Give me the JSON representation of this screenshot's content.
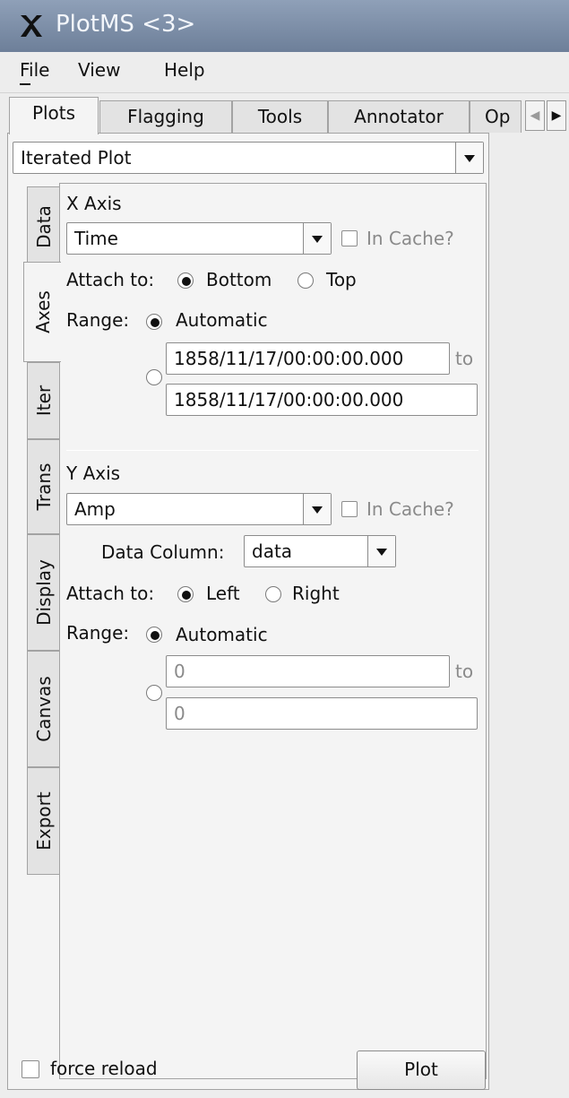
{
  "window": {
    "title": "PlotMS <3>"
  },
  "menu": {
    "items": [
      "File",
      "View",
      "Help"
    ]
  },
  "tabs": [
    "Plots",
    "Flagging",
    "Tools",
    "Annotator",
    "Op"
  ],
  "plot_type": "Iterated Plot",
  "side_tabs": [
    "Data",
    "Axes",
    "Iter",
    "Trans",
    "Display",
    "Canvas",
    "Export"
  ],
  "x_axis": {
    "heading": "X Axis",
    "value": "Time",
    "in_cache_label": "In Cache?",
    "attach_label": "Attach to:",
    "attach_options": [
      "Bottom",
      "Top"
    ],
    "attach_selected": "Bottom",
    "range_label": "Range:",
    "range_auto_label": "Automatic",
    "range_from": "1858/11/17/00:00:00.000",
    "range_to": "1858/11/17/00:00:00.000",
    "to_label": "to"
  },
  "y_axis": {
    "heading": "Y Axis",
    "value": "Amp",
    "in_cache_label": "In Cache?",
    "data_column_label": "Data Column:",
    "data_column_value": "data",
    "attach_label": "Attach to:",
    "attach_options": [
      "Left",
      "Right"
    ],
    "attach_selected": "Left",
    "range_label": "Range:",
    "range_auto_label": "Automatic",
    "range_from": "0",
    "range_to": "0",
    "to_label": "to"
  },
  "footer": {
    "force_reload_label": "force reload",
    "plot_button": "Plot"
  }
}
